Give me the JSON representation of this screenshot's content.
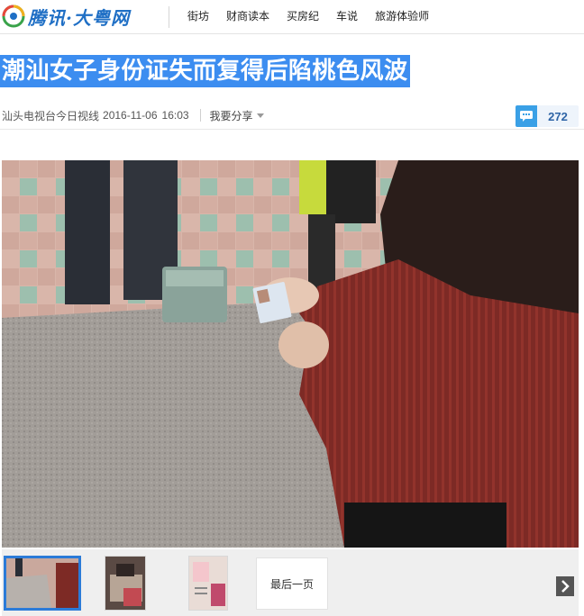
{
  "header": {
    "logo_text": "腾讯·大粤网",
    "nav": [
      "街坊",
      "财商读本",
      "买房纪",
      "车说",
      "旅游体验师"
    ]
  },
  "article": {
    "title": "潮汕女子身份证失而复得后陷桃色风波",
    "source": "汕头电视台今日视线",
    "date": "2016-11-06",
    "time": "16:03",
    "share_label": "我要分享",
    "comment_count": "272"
  },
  "gallery": {
    "last_page_label": "最后一页"
  },
  "colors": {
    "title_highlight": "#3c8df0",
    "brand_blue": "#1f6fc5",
    "comment_blue": "#3aa0e6",
    "active_thumb_border": "#2b7bd8"
  }
}
